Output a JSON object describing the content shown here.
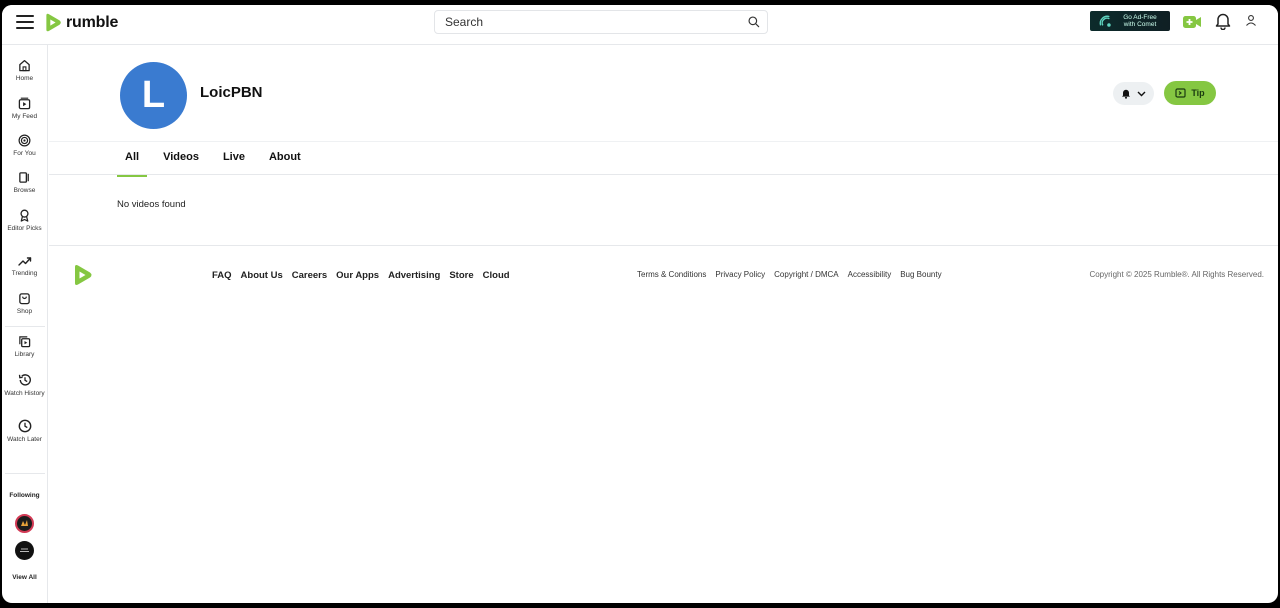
{
  "header": {
    "logo_text": "rumble",
    "search_placeholder": "Search",
    "adfree_line1": "Go Ad-Free",
    "adfree_line2": "with Comet"
  },
  "sidebar": {
    "items": [
      {
        "label": "Home"
      },
      {
        "label": "My Feed"
      },
      {
        "label": "For You"
      },
      {
        "label": "Browse"
      },
      {
        "label": "Editor Picks"
      },
      {
        "label": "Trending"
      },
      {
        "label": "Shop"
      },
      {
        "label": "Library"
      },
      {
        "label": "Watch History"
      },
      {
        "label": "Watch Later"
      }
    ],
    "following_label": "Following",
    "view_all_label": "View All"
  },
  "channel": {
    "avatar_letter": "L",
    "name": "LoicPBN",
    "tip_label": "Tip"
  },
  "tabs": [
    "All",
    "Videos",
    "Live",
    "About"
  ],
  "empty_message": "No videos found",
  "footer": {
    "links": [
      "FAQ",
      "About Us",
      "Careers",
      "Our Apps",
      "Advertising",
      "Store",
      "Cloud"
    ],
    "legal_links": [
      "Terms & Conditions",
      "Privacy Policy",
      "Copyright / DMCA",
      "Accessibility",
      "Bug Bounty"
    ],
    "copyright": "Copyright © 2025 Rumble®. All Rights Reserved."
  },
  "colors": {
    "brand_green": "#85c742",
    "avatar_blue": "#3a7bd0"
  }
}
